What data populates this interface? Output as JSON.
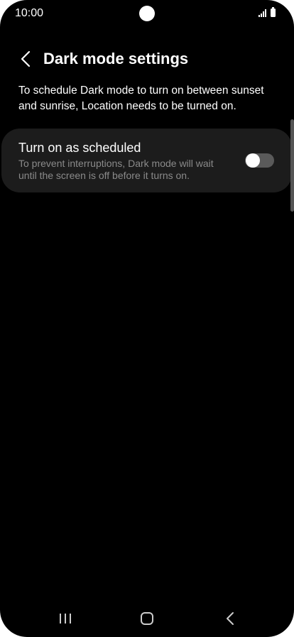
{
  "status_bar": {
    "time": "10:00",
    "icons": [
      "camera-cutout",
      "signal-icon",
      "battery-icon"
    ]
  },
  "header": {
    "back_icon": "chevron-left-icon",
    "title": "Dark mode settings"
  },
  "info_text": "To schedule Dark mode to turn on between sunset and sunrise, Location needs to be turned on.",
  "setting": {
    "title": "Turn on as scheduled",
    "description": "To prevent interruptions, Dark mode will wait until the screen is off before it turns on.",
    "toggle_on": false
  },
  "nav_bar": {
    "buttons": [
      "recent-apps-icon",
      "home-icon",
      "back-icon"
    ]
  },
  "colors": {
    "background": "#000000",
    "card": "#1c1c1c",
    "secondary_text": "#8a8a8a",
    "toggle_track_off": "#5a5a5a"
  }
}
